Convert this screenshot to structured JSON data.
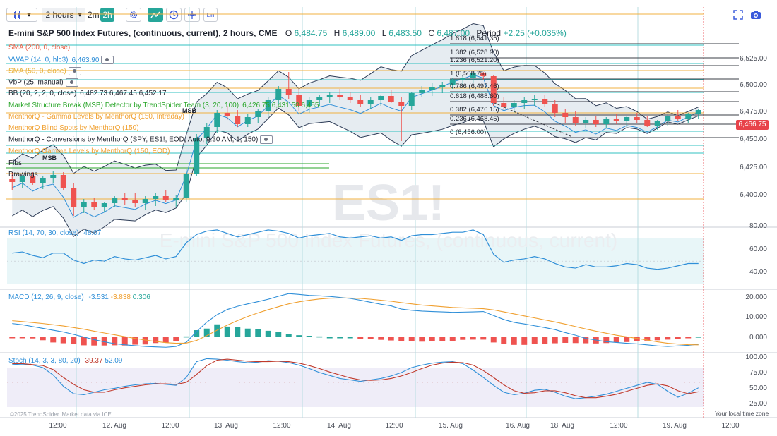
{
  "toolbar": {
    "interval_label": "2 hours",
    "interval_2m": "2m",
    "interval_2h": "2h",
    "lin_label": "Lin",
    "chevron": "▾"
  },
  "header": {
    "title": "E-mini S&P 500 Index Futures, (continuous, current), 2 hours, CME",
    "o_label": "O",
    "o_value": "6,484.75",
    "h_label": "H",
    "h_value": "6,489.00",
    "l_label": "L",
    "l_value": "6,483.50",
    "c_label": "C",
    "c_value": "6,487.00",
    "period_label": "Period",
    "period_value": "+2.25 (+0.035%)"
  },
  "indicators": [
    {
      "text": "SMA (200, 0, close)",
      "color": "#e8634a"
    },
    {
      "text": "VWAP (14, 0, hlc3)",
      "value": "6,463.90",
      "color": "#2f8fd8"
    },
    {
      "text": "SMA (50, 0, close)",
      "color": "#e8b23a"
    },
    {
      "text": "VbP (25, manual)",
      "color": "#1e222d"
    },
    {
      "text": "BB (20, 2, 2, 0, close)",
      "value": "6,482.73  6,467.45  6,452.17",
      "color": "#1e222d"
    },
    {
      "text": "Market Structure Break (MSB) Detector by TrendSpider Team (3, 20, 100)",
      "value": "6,426.75  6,431.50  6,455",
      "color": "#2aa62a"
    },
    {
      "text": "MenthorQ - Gamma Levels by MenthorQ (150, Intraday)",
      "color": "#f0a030"
    },
    {
      "text": "MenthorQ Blind Spots by MenthorQ (150)",
      "color": "#f0a030"
    },
    {
      "text": "MenthorQ - Conversions by MenthorQ (SPY, ES1!, EOD, Auto, 9:30 AM, 1, 150)",
      "color": "#1e222d"
    },
    {
      "text": "MenthorQ Gamma Levels by MenthorQ (150, EOD)",
      "color": "#f0a030"
    },
    {
      "text": "Fibs",
      "color": "#1e222d"
    },
    {
      "text": "Drawings",
      "color": "#1e222d"
    }
  ],
  "msb_labels": [
    "MSB",
    "MSB"
  ],
  "watermark": {
    "symbol": "ES1!",
    "name": "E-mini S&P 500 Index Futures, (continuous, current)"
  },
  "fib_levels": [
    {
      "text": "1.618 (6,541.35)"
    },
    {
      "text": "1.382 (6,528.90)"
    },
    {
      "text": "1.236 (6,521.20)"
    },
    {
      "text": "1 (6,508.75)"
    },
    {
      "text": "0.786 (6,497.46)"
    },
    {
      "text": "0.618 (6,488.60)"
    },
    {
      "text": "0.382 (6,476.15)"
    },
    {
      "text": "0.236 (6,468.45)"
    },
    {
      "text": "0 (6,456.00)"
    }
  ],
  "price_axis": [
    "6,525.00",
    "6,500.00",
    "6,475.00",
    "6,450.00",
    "6,425.00",
    "6,400.00"
  ],
  "last_price": {
    "value": "6,466.75",
    "color": "#e8434a"
  },
  "rsi": {
    "label": "RSI (14, 70, 30, close)",
    "value": "48.07",
    "axis": [
      "80.00",
      "60.00",
      "40.00"
    ]
  },
  "macd": {
    "label": "MACD (12, 26, 9, close)",
    "macd": "-3.531",
    "signal": "-3.838",
    "hist": "0.306",
    "axis": [
      "20.000",
      "10.000",
      "0.000"
    ]
  },
  "stoch": {
    "label": "Stoch (14, 3, 3, 80, 20)",
    "k": "39.37",
    "d": "52.09",
    "axis": [
      "100.00",
      "75.00",
      "50.00",
      "25.00"
    ]
  },
  "time_axis": [
    "12:00",
    "12. Aug",
    "12:00",
    "13. Aug",
    "12:00",
    "14. Aug",
    "12:00",
    "15. Aug",
    "16. Aug",
    "18. Aug",
    "12:00",
    "19. Aug",
    "12:00"
  ],
  "footer": {
    "credit": "©2025 TrendSpider. Market data via ICE.",
    "timezone": "Your local time zone"
  },
  "chart_data": {
    "type": "candlestick",
    "symbol": "ES1!",
    "interval": "2 hours",
    "ylim": [
      6385,
      6540
    ],
    "ohlc": [
      [
        6418,
        6423,
        6410,
        6416
      ],
      [
        6416,
        6421,
        6412,
        6420
      ],
      [
        6420,
        6423,
        6414,
        6415
      ],
      [
        6415,
        6420,
        6411,
        6419
      ],
      [
        6419,
        6424,
        6415,
        6421
      ],
      [
        6421,
        6423,
        6410,
        6412
      ],
      [
        6412,
        6415,
        6392,
        6398
      ],
      [
        6398,
        6404,
        6394,
        6402
      ],
      [
        6402,
        6405,
        6396,
        6398
      ],
      [
        6398,
        6402,
        6395,
        6401
      ],
      [
        6401,
        6406,
        6398,
        6405
      ],
      [
        6405,
        6408,
        6400,
        6403
      ],
      [
        6403,
        6408,
        6398,
        6401
      ],
      [
        6401,
        6406,
        6396,
        6404
      ],
      [
        6404,
        6408,
        6399,
        6406
      ],
      [
        6406,
        6410,
        6402,
        6403
      ],
      [
        6403,
        6407,
        6398,
        6405
      ],
      [
        6405,
        6425,
        6402,
        6422
      ],
      [
        6422,
        6450,
        6420,
        6447
      ],
      [
        6447,
        6458,
        6443,
        6455
      ],
      [
        6455,
        6467,
        6451,
        6465
      ],
      [
        6465,
        6470,
        6460,
        6463
      ],
      [
        6463,
        6467,
        6455,
        6457
      ],
      [
        6457,
        6464,
        6455,
        6462
      ],
      [
        6462,
        6468,
        6458,
        6466
      ],
      [
        6466,
        6476,
        6462,
        6474
      ],
      [
        6474,
        6484,
        6471,
        6482
      ],
      [
        6482,
        6494,
        6475,
        6478
      ],
      [
        6478,
        6482,
        6466,
        6470
      ],
      [
        6470,
        6476,
        6465,
        6474
      ],
      [
        6474,
        6478,
        6470,
        6476
      ],
      [
        6476,
        6480,
        6472,
        6478
      ],
      [
        6478,
        6482,
        6474,
        6476
      ],
      [
        6476,
        6480,
        6472,
        6474
      ],
      [
        6474,
        6478,
        6469,
        6471
      ],
      [
        6471,
        6476,
        6468,
        6474
      ],
      [
        6474,
        6478,
        6470,
        6477
      ],
      [
        6477,
        6481,
        6472,
        6473
      ],
      [
        6473,
        6476,
        6445,
        6470
      ],
      [
        6470,
        6480,
        6467,
        6479
      ],
      [
        6479,
        6484,
        6476,
        6481
      ],
      [
        6481,
        6486,
        6477,
        6483
      ],
      [
        6483,
        6487,
        6479,
        6485
      ],
      [
        6485,
        6490,
        6482,
        6488
      ],
      [
        6488,
        6492,
        6484,
        6490
      ],
      [
        6490,
        6494,
        6486,
        6493
      ],
      [
        6493,
        6494,
        6488,
        6491
      ],
      [
        6491,
        6492,
        6470,
        6472
      ],
      [
        6472,
        6476,
        6467,
        6469
      ],
      [
        6469,
        6474,
        6465,
        6472
      ],
      [
        6472,
        6476,
        6468,
        6474
      ],
      [
        6474,
        6478,
        6470,
        6475
      ],
      [
        6475,
        6478,
        6469,
        6471
      ],
      [
        6471,
        6474,
        6462,
        6465
      ],
      [
        6465,
        6468,
        6458,
        6462
      ],
      [
        6462,
        6466,
        6456,
        6458
      ],
      [
        6458,
        6462,
        6454,
        6460
      ],
      [
        6460,
        6463,
        6455,
        6457
      ],
      [
        6457,
        6462,
        6454,
        6461
      ],
      [
        6461,
        6464,
        6457,
        6459
      ],
      [
        6459,
        6463,
        6455,
        6462
      ],
      [
        6462,
        6465,
        6458,
        6460
      ],
      [
        6460,
        6463,
        6455,
        6456
      ],
      [
        6456,
        6460,
        6453,
        6459
      ],
      [
        6459,
        6464,
        6456,
        6463
      ],
      [
        6463,
        6467,
        6459,
        6461
      ],
      [
        6461,
        6465,
        6458,
        6464
      ],
      [
        6464,
        6468,
        6461,
        6467
      ]
    ],
    "rsi": [
      57,
      58,
      55,
      53,
      57,
      57,
      51,
      48,
      51,
      50,
      54,
      52,
      51,
      53,
      55,
      52,
      54,
      66,
      73,
      76,
      77,
      74,
      71,
      73,
      75,
      77,
      76,
      74,
      70,
      72,
      73,
      74,
      71,
      70,
      71,
      72,
      70,
      71,
      68,
      72,
      73,
      73,
      74,
      75,
      75,
      77,
      73,
      56,
      49,
      51,
      52,
      54,
      52,
      48,
      45,
      44,
      47,
      45,
      45,
      46,
      48,
      47,
      44,
      43,
      44,
      46,
      48,
      48
    ],
    "macd_line": [
      6.8,
      6.2,
      5.3,
      4.4,
      3.5,
      2.6,
      1.4,
      0.1,
      -1.2,
      -2.3,
      -3.2,
      -3.8,
      -4.2,
      -4.6,
      -4.8,
      -5.0,
      -4.6,
      -2.5,
      2.8,
      7.5,
      11.2,
      13.8,
      15.4,
      16.6,
      17.7,
      18.9,
      20.4,
      21.7,
      21.3,
      20.8,
      20.6,
      20.3,
      19.8,
      19.3,
      18.4,
      17.4,
      16.4,
      15.6,
      14.0,
      13.4,
      13.0,
      12.8,
      12.6,
      12.4,
      12.5,
      12.6,
      12.8,
      10.8,
      8.8,
      7.4,
      6.6,
      5.7,
      4.8,
      3.8,
      2.3,
      1.0,
      -0.6,
      -1.4,
      -2.2,
      -2.6,
      -3.0,
      -3.3,
      -3.8,
      -4.3,
      -4.6,
      -4.3,
      -4.0,
      -3.5
    ],
    "macd_signal": [
      8.2,
      7.8,
      7.3,
      6.8,
      6.2,
      5.6,
      4.8,
      4.0,
      3.0,
      2.1,
      1.2,
      0.3,
      -0.6,
      -1.4,
      -2.1,
      -2.7,
      -3.0,
      -2.9,
      -1.6,
      0.8,
      3.5,
      6.0,
      8.3,
      10.3,
      12.1,
      13.7,
      15.2,
      16.6,
      17.6,
      18.4,
      19.0,
      19.4,
      19.5,
      19.5,
      19.3,
      18.9,
      18.4,
      17.9,
      17.2,
      16.6,
      16.0,
      15.6,
      15.2,
      14.8,
      14.6,
      14.4,
      14.2,
      13.6,
      12.6,
      11.6,
      10.6,
      9.6,
      8.6,
      7.6,
      6.5,
      5.3,
      4.1,
      3.0,
      2.0,
      1.0,
      0.2,
      -0.6,
      -1.4,
      -2.3,
      -3.0,
      -3.4,
      -3.7,
      -3.8
    ],
    "macd_hist": [
      -0.3,
      -0.4,
      -0.6,
      -1.5,
      -2.6,
      -3.0,
      -3.4,
      -4.0,
      -4.1,
      -4.1,
      -4.0,
      -4.1,
      -3.7,
      -3.6,
      -2.9,
      -2.7,
      -1.8,
      0.4,
      3.5,
      4.3,
      6.4,
      5.3,
      5.2,
      4.3,
      4.1,
      3.2,
      2.8,
      1.5,
      1.0,
      0.7,
      0.4,
      0,
      0,
      0,
      -0.8,
      -1.0,
      -1.3,
      -1.6,
      -2.0,
      -2.1,
      -2.2,
      -2.1,
      -1.9,
      -1.8,
      -1.3,
      -1.2,
      -1.2,
      -2.6,
      -3.3,
      -3.8,
      -3.8,
      -3.3,
      -3.2,
      -3.0,
      -2.8,
      -2.9,
      -3.0,
      -3.1,
      -2.9,
      -2.6,
      -2.4,
      -2.0,
      -1.7,
      -1.5,
      -1.2,
      -0.8,
      -0.4,
      0.3
    ],
    "stoch_k": [
      86,
      87,
      85,
      80,
      65,
      42,
      27,
      25,
      30,
      35,
      38,
      42,
      45,
      47,
      48,
      46,
      44,
      60,
      92,
      98,
      97,
      95,
      92,
      90,
      91,
      94,
      93,
      90,
      85,
      78,
      70,
      64,
      58,
      55,
      52,
      55,
      58,
      63,
      70,
      80,
      85,
      89,
      91,
      92,
      88,
      75,
      60,
      44,
      30,
      25,
      28,
      34,
      36,
      30,
      22,
      17,
      19,
      22,
      26,
      32,
      38,
      44,
      50,
      46,
      32,
      20,
      28,
      39
    ],
    "stoch_d": [
      88,
      88,
      86,
      84,
      76,
      60,
      46,
      35,
      30,
      30,
      35,
      39,
      42,
      45,
      47,
      47,
      46,
      50,
      66,
      84,
      95,
      97,
      95,
      93,
      92,
      92,
      93,
      92,
      89,
      84,
      78,
      71,
      65,
      59,
      55,
      54,
      55,
      58,
      63,
      70,
      78,
      85,
      89,
      91,
      90,
      85,
      74,
      60,
      45,
      33,
      28,
      29,
      33,
      33,
      29,
      23,
      19,
      19,
      22,
      26,
      32,
      38,
      44,
      47,
      43,
      33,
      27,
      31
    ],
    "sma_200": 6478,
    "sma_50": 6483,
    "vwap": 6463.9,
    "bb": {
      "upper": 6482.73,
      "middle": 6467.45,
      "lower": 6452.17
    }
  }
}
